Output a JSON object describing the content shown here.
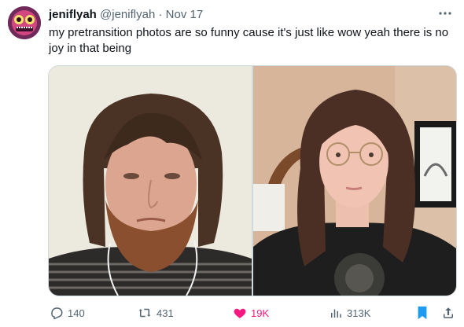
{
  "tweet": {
    "author_name": "jeniflyah",
    "author_handle": "@jeniflyah",
    "separator": "·",
    "date": "Nov 17",
    "text": "my pretransition photos are so funny cause it's just like wow yeah there is no joy in that being"
  },
  "actions": {
    "replies": "140",
    "reposts": "431",
    "likes": "19K",
    "views": "313K"
  },
  "colors": {
    "like_accent": "#f91880",
    "bookmark_accent": "#1d9bf0",
    "secondary_text": "#536471"
  },
  "icons": [
    "more-icon",
    "reply-icon",
    "repost-icon",
    "heart-icon",
    "views-icon",
    "bookmark-icon",
    "share-icon"
  ]
}
